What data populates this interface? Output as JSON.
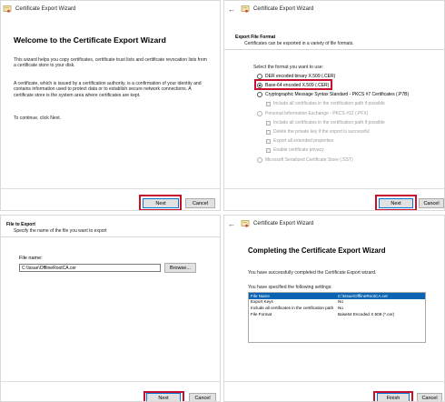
{
  "colors": {
    "highlight": "#c8102e",
    "selection": "#0a64b4",
    "primary_border": "#0078d7"
  },
  "wizard_title": "Certificate Export Wizard",
  "welcome": {
    "heading": "Welcome to the Certificate Export Wizard",
    "p1": "This wizard helps you copy certificates, certificate trust lists and certificate revocation lists from a certificate store to your disk.",
    "p2": "A certificate, which is issued by a certification authority, is a confirmation of your identity and contains information used to protect data or to establish secure network connections. A certificate store is the system area where certificates are kept.",
    "p3": "To continue, click Next.",
    "next": "Next",
    "cancel": "Cancel"
  },
  "format": {
    "header_title": "Export File Format",
    "header_sub": "Certificates can be exported in a variety of file formats.",
    "prompt": "Select the format you want to use:",
    "options": [
      "DER encoded binary X.509 (.CER)",
      "Base-64 encoded X.509 (.CER)",
      "Cryptographic Message Syntax Standard - PKCS #7 Certificates (.P7B)",
      "Include all certificates in the certification path if possible",
      "Personal Information Exchange - PKCS #12 (.PFX)",
      "Include all certificates in the certification path if possible",
      "Delete the private key if the export is successful",
      "Export all extended properties",
      "Enable certificate privacy",
      "Microsoft Serialized Certificate Store (.SST)"
    ],
    "next": "Next",
    "cancel": "Cancel"
  },
  "file": {
    "header_title": "File to Export",
    "header_sub": "Specify the name of the file you want to export",
    "label": "File name:",
    "value": "C:\\Issue\\OfflineRootCA.cer",
    "browse": "Browse...",
    "next": "Next",
    "cancel": "Cancel"
  },
  "complete": {
    "heading": "Completing the Certificate Export Wizard",
    "intro": "You have successfully completed the Certificate Export wizard.",
    "settings_label": "You have specified the following settings:",
    "rows": [
      {
        "k": "File Name",
        "v": "C:\\Issue\\OfflineRootCA.cer"
      },
      {
        "k": "Export Keys",
        "v": "No"
      },
      {
        "k": "Include all certificates in the certification path",
        "v": "No"
      },
      {
        "k": "File Format",
        "v": "Base64 Encoded X.509 (*.cer)"
      }
    ],
    "finish": "Finish",
    "cancel": "Cancel"
  }
}
